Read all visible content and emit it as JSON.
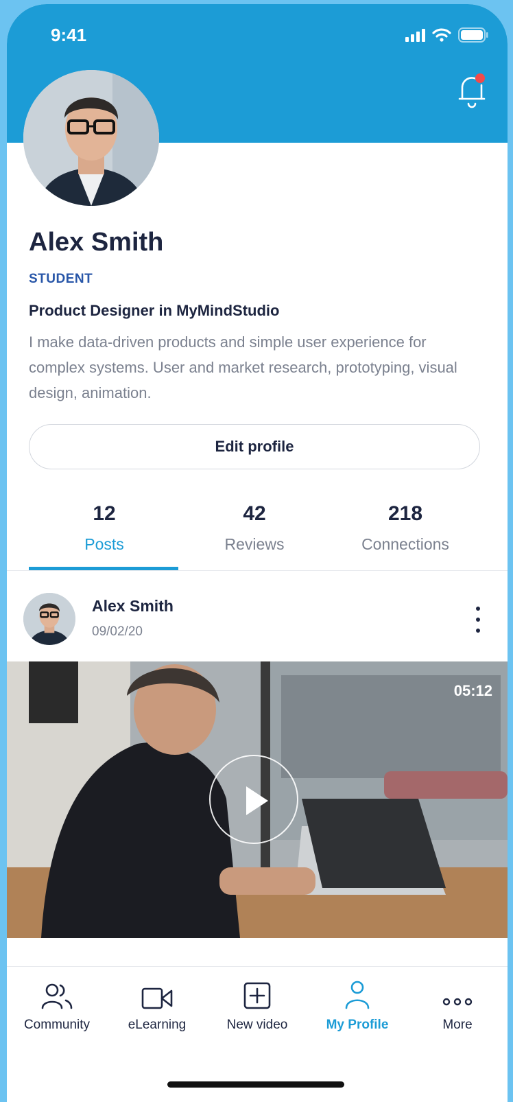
{
  "status_bar": {
    "time": "9:41"
  },
  "profile": {
    "name": "Alex Smith",
    "role": "STUDENT",
    "headline": "Product Designer in MyMindStudio",
    "bio": "I make data-driven products and simple user experience for complex systems. User and market research, prototyping, visual design, animation.",
    "edit_button": "Edit profile"
  },
  "stats": [
    {
      "value": "12",
      "label": "Posts",
      "active": true
    },
    {
      "value": "42",
      "label": "Reviews",
      "active": false
    },
    {
      "value": "218",
      "label": "Connections",
      "active": false
    }
  ],
  "post": {
    "author": "Alex Smith",
    "date": "09/02/20",
    "video_duration": "05:12"
  },
  "tab_bar": [
    {
      "label": "Community",
      "icon": "community-icon",
      "active": false
    },
    {
      "label": "eLearning",
      "icon": "video-camera-icon",
      "active": false
    },
    {
      "label": "New video",
      "icon": "add-square-icon",
      "active": false
    },
    {
      "label": "My Profile",
      "icon": "user-icon",
      "active": true
    },
    {
      "label": "More",
      "icon": "more-dots-icon",
      "active": false
    }
  ],
  "colors": {
    "accent": "#1c9cd6",
    "text": "#1d2540",
    "muted": "#7b818f",
    "role": "#2856a8",
    "notification": "#f24a4a"
  }
}
